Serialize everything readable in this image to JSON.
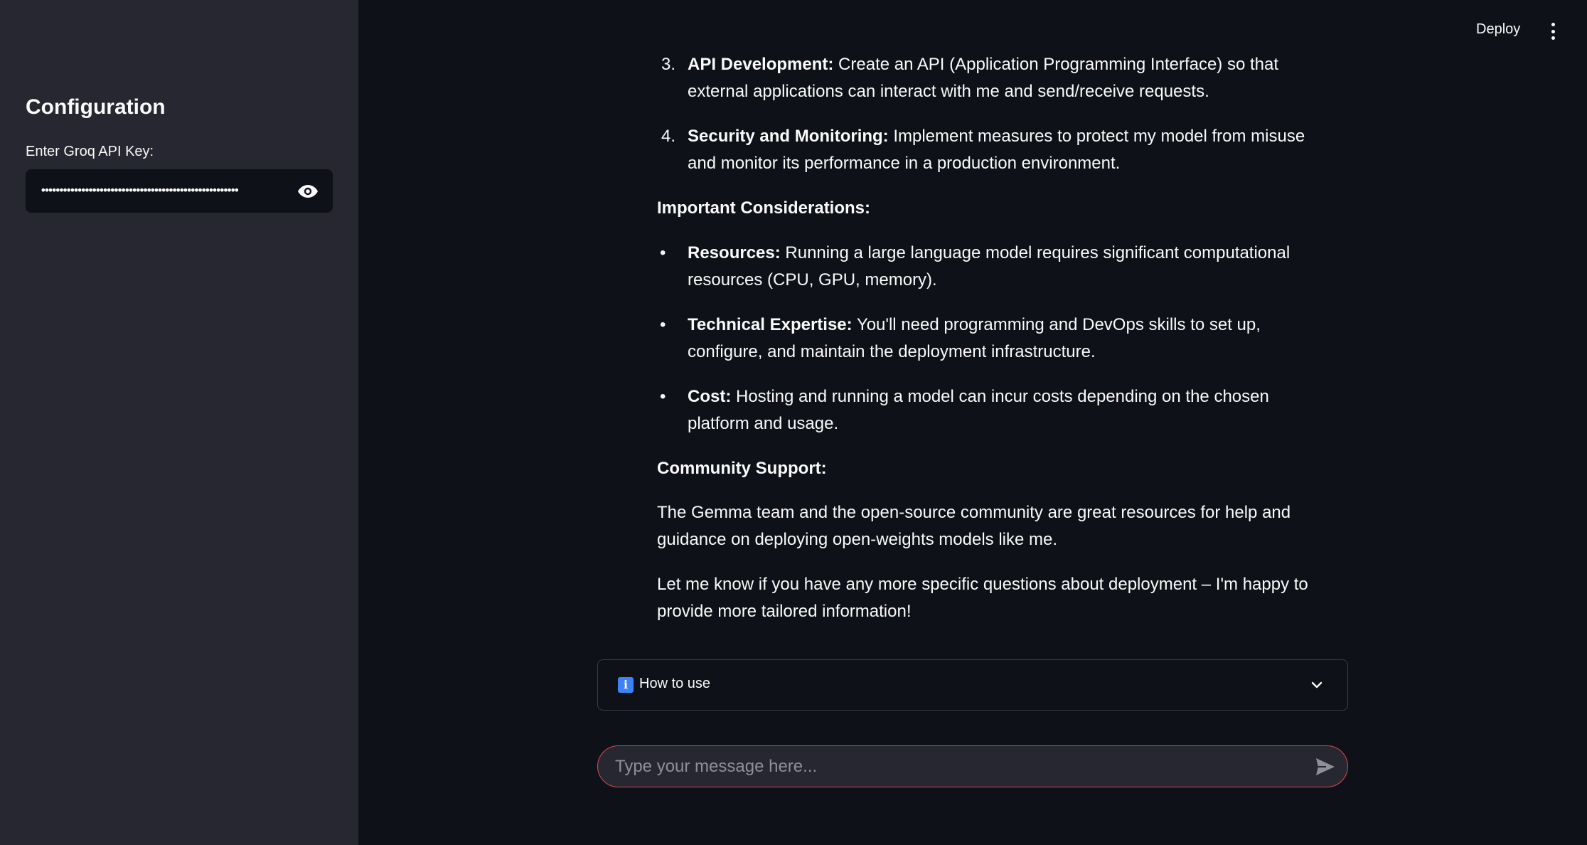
{
  "sidebar": {
    "title": "Configuration",
    "api_key_label": "Enter Groq API Key:",
    "api_key_value": "••••••••••••••••••••••••••••••••••••••••••••••••••••••"
  },
  "header": {
    "deploy_label": "Deploy"
  },
  "main": {
    "steps": [
      {
        "num": "3.",
        "bold": "API Development:",
        "text": " Create an API (Application Programming Interface) so that external applications can interact with me and send/receive requests."
      },
      {
        "num": "4.",
        "bold": "Security and Monitoring:",
        "text": " Implement measures to protect my model from misuse and monitor its performance in a production environment."
      }
    ],
    "considerations_heading": "Important Considerations:",
    "considerations": [
      {
        "bold": "Resources:",
        "text": " Running a large language model requires significant computational resources (CPU, GPU, memory)."
      },
      {
        "bold": "Technical Expertise:",
        "text": " You'll need programming and DevOps skills to set up, configure, and maintain the deployment infrastructure."
      },
      {
        "bold": "Cost:",
        "text": " Hosting and running a model can incur costs depending on the chosen platform and usage."
      }
    ],
    "community_heading": "Community Support:",
    "community_text": "The Gemma team and the open-source community are great resources for help and guidance on deploying open-weights models like me.",
    "closing_text": "Let me know if you have any more specific questions about deployment – I'm happy to provide more tailored information!"
  },
  "expander": {
    "icon": "info-icon",
    "label": "How to use"
  },
  "chat_input": {
    "placeholder": "Type your message here..."
  },
  "colors": {
    "background": "#0e1117",
    "sidebar": "#262730",
    "accent_border": "#e0474c",
    "info_blue": "#3d82f6"
  }
}
